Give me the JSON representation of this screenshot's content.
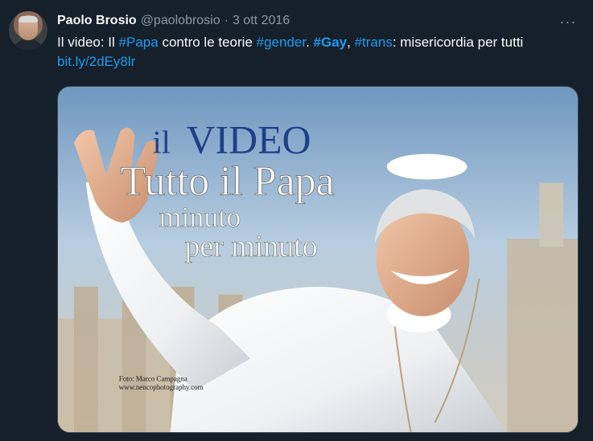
{
  "author": {
    "name": "Paolo Brosio",
    "handle": "@paolobrosio",
    "separator": "·",
    "date": "3 ott 2016"
  },
  "more_label": "···",
  "tweet": {
    "t1": "Il video: Il ",
    "tag_papa": "#Papa",
    "t2": " contro le teorie ",
    "tag_gender": "#gender",
    "t3": ". ",
    "tag_gay": "#Gay",
    "t4": ", ",
    "tag_trans": "#trans",
    "t5": ": misericordia per tutti ",
    "link": "bit.ly/2dEy8lr"
  },
  "media": {
    "overlay_il": "il",
    "overlay_video": "VIDEO",
    "overlay_line2": "Tutto il Papa",
    "overlay_line3": "minuto",
    "overlay_line4": "per minuto",
    "credit1": "Foto: Marco Campagna",
    "credit2": "www.nencophotography.com"
  },
  "colors": {
    "background": "#15202b",
    "accent": "#1d9bf0",
    "muted": "#8b98a5"
  }
}
